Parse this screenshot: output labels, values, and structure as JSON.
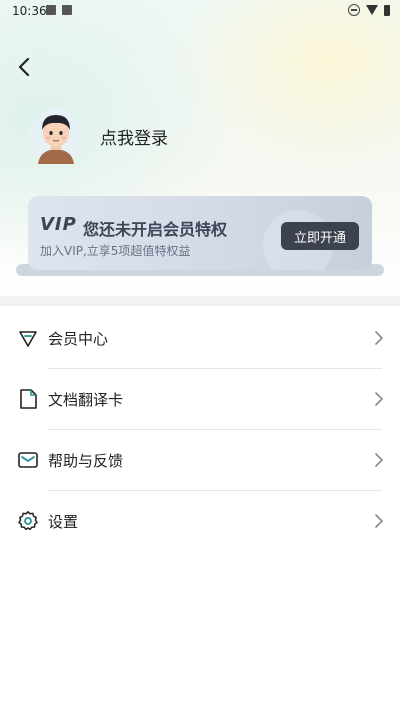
{
  "status_bar": {
    "time": "10:36"
  },
  "profile": {
    "login_text": "点我登录"
  },
  "vip": {
    "logo": "VIP",
    "title": "您还未开启会员特权",
    "subtitle": "加入VIP,立享5项超值特权益",
    "button": "立即开通"
  },
  "menu": {
    "items": [
      {
        "label": "会员中心",
        "icon": "diamond-icon"
      },
      {
        "label": "文档翻译卡",
        "icon": "document-icon"
      },
      {
        "label": "帮助与反馈",
        "icon": "mail-icon"
      },
      {
        "label": "设置",
        "icon": "gear-icon"
      }
    ]
  },
  "colors": {
    "accent_teal": "#1f8f94",
    "vip_button": "#3c4250"
  }
}
